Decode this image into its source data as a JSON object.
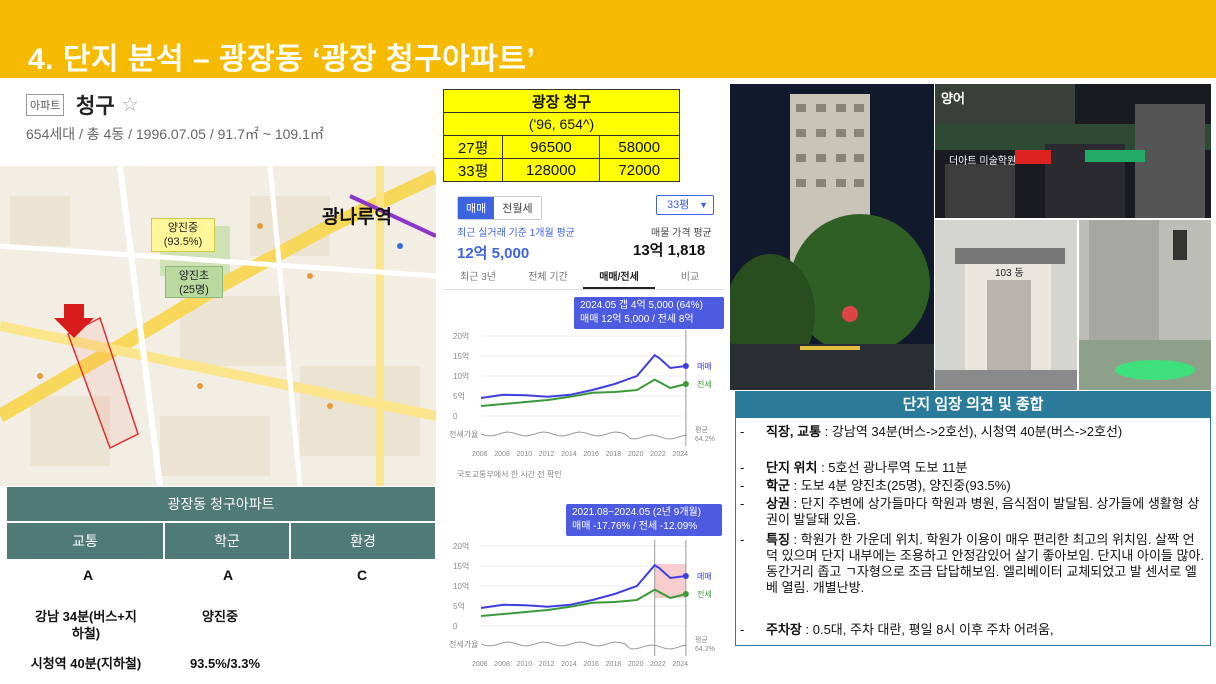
{
  "title": "4. 단지 분석 – 광장동 ‘광장 청구아파트’",
  "listing": {
    "tag": "아파트",
    "name": "청구",
    "star": "☆",
    "info": "654세대 / 총 4동 / 1996.07.05 / 91.7㎡ ~ 109.1㎡"
  },
  "map": {
    "station": "광나루역",
    "school_middle": "양진중\n(93.5%)",
    "school_elem": "양진초\n(25명)"
  },
  "summary": {
    "title": "광장동 청구아파트",
    "cols": [
      "교통",
      "학군",
      "환경"
    ],
    "grades": [
      "A",
      "A",
      "C"
    ],
    "transport_1": "강남 34분(버스+지\n하철)",
    "transport_2": "시청역 40분(지하철)",
    "school_1": "양진중",
    "school_2": "93.5%/3.3%"
  },
  "price_table": {
    "name": "광장 청구",
    "sub": "('96, 654^)",
    "rows": [
      {
        "size": "27평",
        "sale": "96500",
        "jeonse": "58000"
      },
      {
        "size": "33평",
        "sale": "128000",
        "jeonse": "72000"
      }
    ]
  },
  "chart_panel": {
    "tab_sale": "매매",
    "tab_jeonse": "전월세",
    "size_select": "33평",
    "avg_label": "최근 실거래 기준 1개월 평균",
    "avg_value": "12억 5,000",
    "listing_label": "매물 가격 평균",
    "listing_value": "13억 1,818",
    "tabs": [
      "최근 3년",
      "전체 기간",
      "매매/전세",
      "비교"
    ],
    "callout1_line1": "2024.05  갭 4억 5,000 (64%)",
    "callout1_line2": "매매 12억 5,000 / 전세 8억",
    "source": "국토교통부에서 한 시간 전 확인",
    "callout2_line1": "2021.08~2024.05 (2년 9개월)",
    "callout2_line2": "매매 -17.76% / 전세 -12.09%",
    "y_ticks": [
      "20억",
      "15억",
      "10억",
      "5억",
      "0"
    ],
    "ratio_label": "전세가율",
    "legend_sale": "매매",
    "legend_jeonse": "전세",
    "avg_small": "평균",
    "avg_pct": "64.2%",
    "x_ticks": [
      "2006",
      "2008",
      "2010",
      "2012",
      "2014",
      "2016",
      "2018",
      "2020",
      "2022",
      "2024"
    ]
  },
  "chart_data": {
    "type": "line",
    "x": [
      2006,
      2008,
      2010,
      2012,
      2014,
      2016,
      2018,
      2020,
      2021.6,
      2022,
      2023,
      2024.4
    ],
    "series": [
      {
        "name": "매매",
        "values": [
          4.5,
          5.3,
          5.2,
          4.8,
          5.3,
          6.5,
          8.0,
          10.0,
          15.2,
          14.5,
          12.0,
          12.5
        ]
      },
      {
        "name": "전세",
        "values": [
          2.5,
          3.0,
          3.5,
          4.0,
          4.8,
          5.8,
          6.0,
          6.5,
          9.1,
          8.5,
          7.0,
          8.0
        ]
      }
    ],
    "ylabel": "",
    "ylim": [
      0,
      20
    ],
    "xlim": [
      2006,
      2024.5
    ]
  },
  "photos": {
    "sign": "양어",
    "building_no": "103 동",
    "shop_sign": "더아트 미술학원"
  },
  "opinion": {
    "title": "단지 임장 의견 및 종합",
    "items": [
      {
        "key": "직장, 교통",
        "text": " : 강남역 34분(버스->2호선), 시청역 40분(버스->2호선)"
      },
      {
        "key": "단지 위치",
        "text": " : 5호선 광나루역 도보 11분"
      },
      {
        "key": "학군",
        "text": " : 도보 4분 양진초(25명), 양진중(93.5%)"
      },
      {
        "key": "상권",
        "text": " : 단지 주변에 상가들마다 학원과 병원, 음식점이 발달됨. 상가들에 생활형 상권이 발달돼 있음."
      },
      {
        "key": "특징",
        "text": " : 학원가 한 가운데 위치. 학원가 이용이 매우 편리한 최고의 위치임. 살짝 언덕 있으며 단지 내부에는 조용하고 안정감있어 살기 좋아보임. 단지내 아이들 많아. 동간거리 좁고 ㄱ자형으로 조금 답답해보임. 엘리베이터 교체되었고 발 센서로 엘베 열림. 개별난방."
      },
      {
        "key": "주차장",
        "text": " : 0.5대, 주차 대란, 평일 8시 이후 주차 어려움,"
      }
    ]
  },
  "colors": {
    "header": "#f6bb00",
    "teal": "#4f7a76",
    "blue_line": "#3f3fe0",
    "green_line": "#3a9a3a",
    "opinion": "#2a7a9a"
  }
}
